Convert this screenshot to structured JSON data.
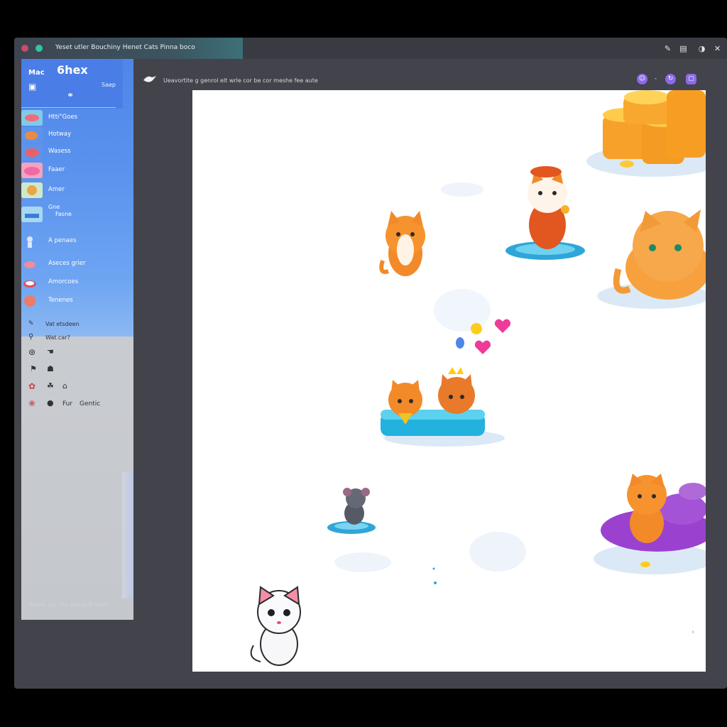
{
  "window": {
    "title": "Yeset utler Bouchiny Henet Cats Pinna boco",
    "controls": [
      "edit-icon",
      "split-icon",
      "shield-icon",
      "close-icon"
    ]
  },
  "sidebar": {
    "app_name": "Mac",
    "app_title": "6hex",
    "app_sub": "Saep",
    "items": [
      {
        "label": "Htti°Goes",
        "icon": "fish-thumb"
      },
      {
        "label": "Hotway",
        "icon": "bread-thumb"
      },
      {
        "label": "Wasess",
        "icon": "crab-thumb"
      },
      {
        "label": "Faaer",
        "icon": "shoe-thumb"
      },
      {
        "label": "Amer",
        "icon": "dog-thumb"
      },
      {
        "label": "Gne",
        "label2": "Fasne",
        "icon": "boat-thumb"
      },
      {
        "label": "A penaes",
        "icon": "figure-thumb"
      },
      {
        "label": "Aseces grier",
        "icon": "shrimp-thumb"
      },
      {
        "label": "Amorcoes",
        "icon": "sushi-thumb"
      },
      {
        "label": "Tenenes",
        "icon": "brain-thumb"
      }
    ],
    "gray_items": [
      {
        "label": "Vat etsdeen"
      },
      {
        "label": "Wat.car?"
      },
      {
        "label": ""
      },
      {
        "label": ""
      },
      {
        "label": ""
      },
      {
        "label": "Fur",
        "extra": "Gentic"
      }
    ],
    "footer": "Aubio cor tite penople lnors"
  },
  "toolbar": {
    "breadcrumb": "Ueavortite g genrol elt wrle cor be cor meshe fee aute",
    "buttons": [
      "smile-icon",
      "minus-icon",
      "refresh-icon",
      "square-icon"
    ],
    "minus_label": "-"
  },
  "game": {
    "characters": [
      "orange-cat-sitting",
      "cat-with-hat-on-pad",
      "big-orange-cat",
      "two-cats-on-cushion",
      "gray-mouse-on-pad",
      "white-kitten",
      "orange-cat-on-purple-rocks"
    ],
    "items": [
      "gold-coin-stack",
      "heart-pink",
      "heart-pink-small",
      "balloon-yellow",
      "balloon-blue",
      "purple-rock-pile"
    ],
    "hint": "›"
  },
  "colors": {
    "sidebar_blue": "#4f86e8",
    "canvas_bg": "#ffffff",
    "window_bg": "#42434b",
    "accent_purple": "#8a6ae8"
  }
}
